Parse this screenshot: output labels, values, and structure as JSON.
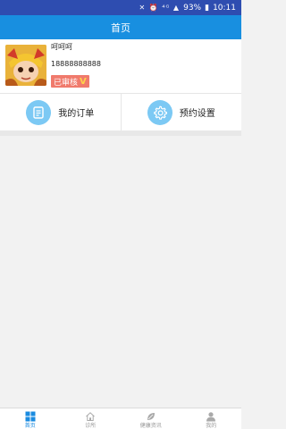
{
  "status_bar": {
    "battery": "93%",
    "time": "10:11"
  },
  "header": {
    "title": "首页"
  },
  "profile": {
    "name": "呵呵呵",
    "phone": "18888888888",
    "badge": "已审核",
    "badge_mark": "V"
  },
  "actions": [
    {
      "label": "我的订单",
      "icon": "document-icon"
    },
    {
      "label": "预约设置",
      "icon": "gear-icon"
    }
  ],
  "tabs": [
    {
      "label": "首页",
      "icon": "grid-icon",
      "active": true
    },
    {
      "label": "诊所",
      "icon": "home-icon",
      "active": false
    },
    {
      "label": "健康资讯",
      "icon": "leaf-icon",
      "active": false
    },
    {
      "label": "我的",
      "icon": "user-icon",
      "active": false
    }
  ],
  "colors": {
    "status_bar": "#2e4db0",
    "title_bar": "#188fe0",
    "accent": "#1a8be0",
    "icon_circle": "#7cc9f4",
    "badge": "#f07a6c"
  }
}
